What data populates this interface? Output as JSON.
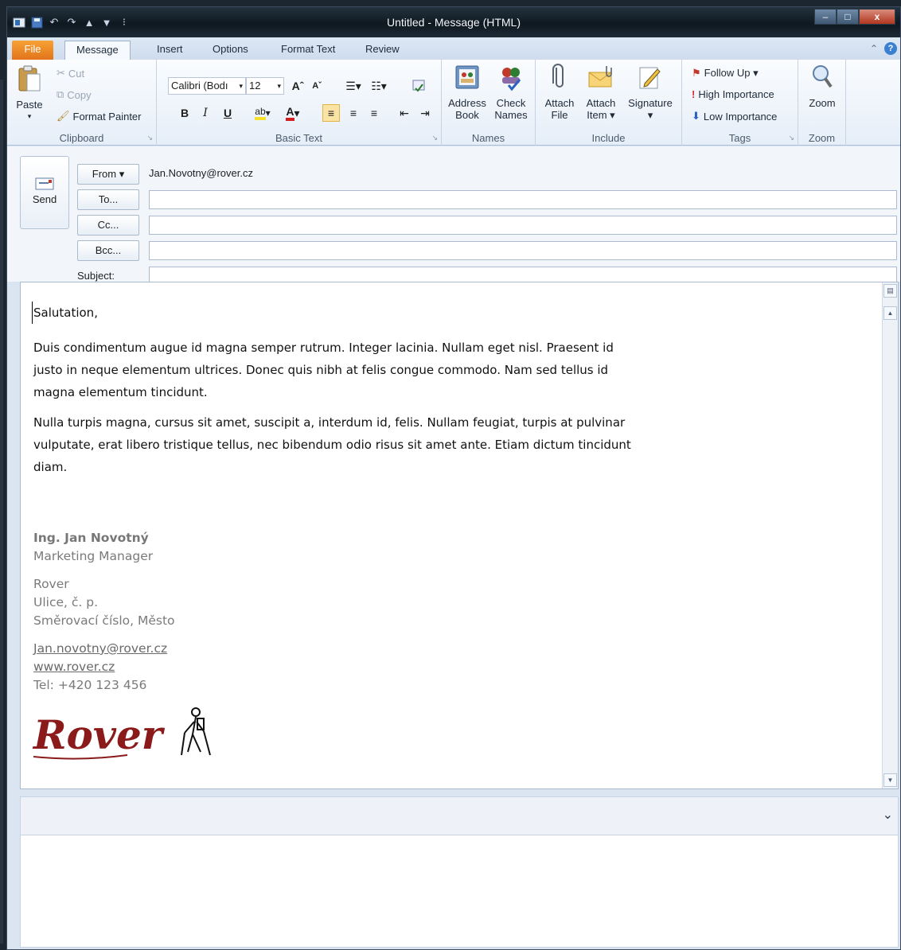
{
  "window": {
    "title": "Untitled - Message (HTML)",
    "controls": {
      "minimize": "–",
      "maximize": "□",
      "close": "x"
    }
  },
  "quick_access": [
    "save-icon",
    "undo-icon",
    "redo-icon",
    "up-arrow-icon",
    "down-arrow-icon",
    "customize-icon"
  ],
  "tabs": [
    {
      "label": "File"
    },
    {
      "label": "Message"
    },
    {
      "label": "Insert"
    },
    {
      "label": "Options"
    },
    {
      "label": "Format Text"
    },
    {
      "label": "Review"
    }
  ],
  "ribbon": {
    "clipboard": {
      "paste": "Paste",
      "cut": "Cut",
      "copy": "Copy",
      "format_painter": "Format Painter",
      "label": "Clipboard"
    },
    "basic_text": {
      "font_name": "Calibri (Body)",
      "font_name_shown": "Calibri (Bodı",
      "font_size": "12",
      "bold": "B",
      "italic": "I",
      "underline": "U",
      "grow": "Aˆ",
      "shrink": "Aˇ",
      "label": "Basic Text"
    },
    "names": {
      "address_book": [
        "Address",
        "Book"
      ],
      "check_names": [
        "Check",
        "Names"
      ],
      "label": "Names"
    },
    "include": {
      "attach_file": [
        "Attach",
        "File"
      ],
      "attach_item": [
        "Attach",
        "Item ▾"
      ],
      "signature": [
        "Signature",
        "▾"
      ],
      "label": "Include"
    },
    "tags": {
      "follow_up": "Follow Up ▾",
      "high_importance": "High Importance",
      "low_importance": "Low Importance",
      "label": "Tags"
    },
    "zoom": {
      "button": "Zoom",
      "label": "Zoom"
    }
  },
  "envelope": {
    "send": "Send",
    "from_button": "From ▾",
    "from_value": "Jan.Novotny@rover.cz",
    "to_button": "To...",
    "cc_button": "Cc...",
    "bcc_button": "Bcc...",
    "subject_label": "Subject:",
    "to_value": "",
    "cc_value": "",
    "bcc_value": "",
    "subject_value": ""
  },
  "message": {
    "salutation": "Salutation,",
    "paragraph1": "Duis condimentum augue id magna semper rutrum. Integer lacinia. Nullam eget nisl. Praesent id justo in neque elementum ultrices. Donec quis nibh at felis congue commodo. Nam sed tellus id magna elementum tincidunt.",
    "paragraph2": "Nulla turpis magna, cursus sit amet, suscipit a, interdum id, felis. Nullam feugiat, turpis at pulvinar vulputate, erat libero tristique tellus, nec bibendum odio risus sit amet ante. Etiam dictum tincidunt diam."
  },
  "signature": {
    "name": "Ing. Jan Novotný",
    "title": "Marketing Manager",
    "company": "Rover",
    "street": "Ulice, č. p.",
    "city": "Směrovací číslo, Město",
    "email": "Jan.novotny@rover.cz",
    "web": "www.rover.cz",
    "tel": "Tel: +420 123 456",
    "logo_text": "Rover"
  },
  "people_pane": {
    "toggle": "⌄"
  },
  "colors": {
    "file_tab": "#e2731a",
    "logo": "#8b1a1a",
    "follow_up_flag": "#c0392b"
  }
}
